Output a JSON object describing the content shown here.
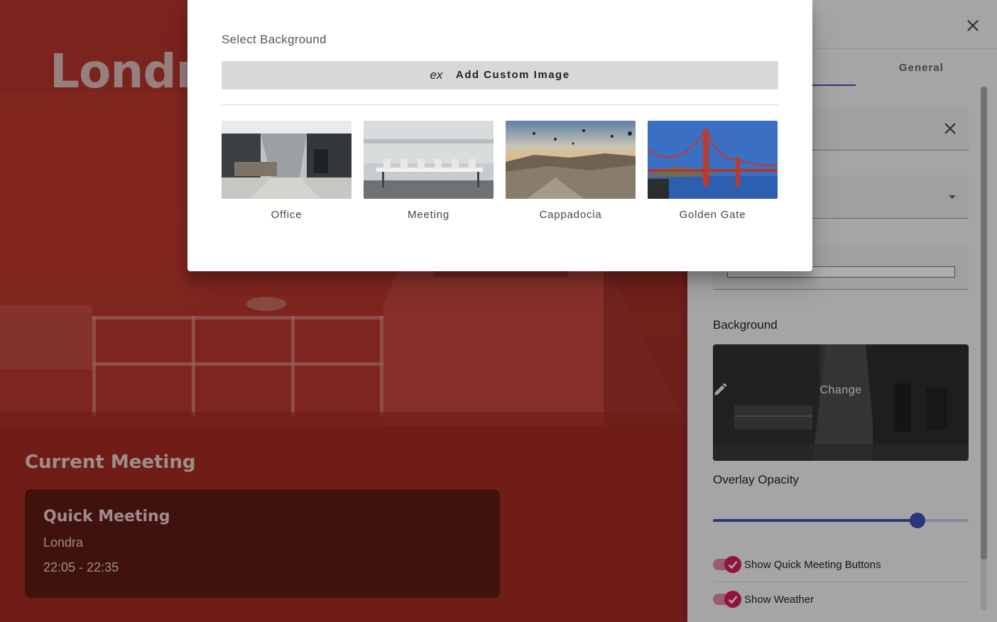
{
  "room": {
    "title": "Londra",
    "current_label": "Current Meeting",
    "meeting": {
      "title": "Quick Meeting",
      "location": "Londra",
      "time": "22:05 - 22:35"
    },
    "overlay_color": "#c0392f"
  },
  "settings": {
    "tab_general": "General",
    "background_label": "Background",
    "change_label": "Change",
    "opacity_label": "Overlay Opacity",
    "opacity_value": 0.8,
    "toggles": [
      {
        "label": "Show Quick Meeting Buttons",
        "on": true
      },
      {
        "label": "Show Weather",
        "on": true
      }
    ],
    "accent": "#3f51b5",
    "toggle_color": "#d81b60"
  },
  "dialog": {
    "title": "Select Background",
    "add_icon_text": "ex",
    "add_button": "Add Custom Image",
    "options": [
      {
        "name": "Office"
      },
      {
        "name": "Meeting"
      },
      {
        "name": "Cappadocia"
      },
      {
        "name": "Golden Gate"
      }
    ]
  }
}
